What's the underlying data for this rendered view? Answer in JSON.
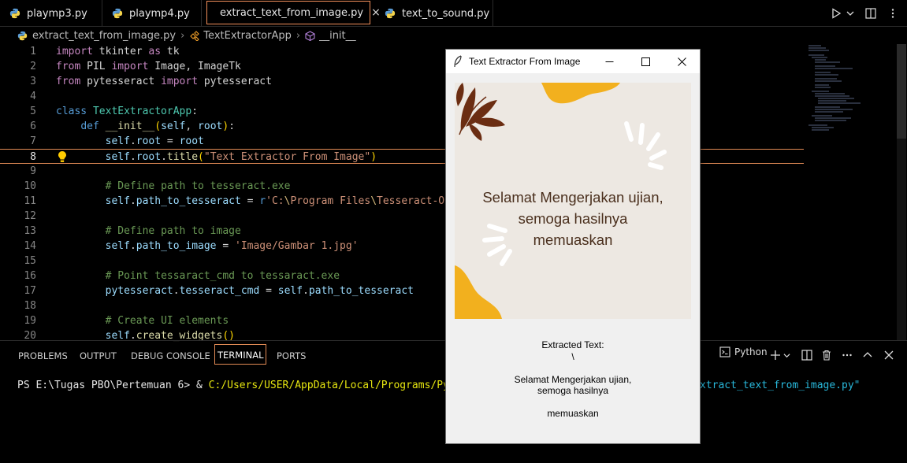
{
  "tabs": [
    {
      "label": "playmp3.py",
      "active": false
    },
    {
      "label": "playmp4.py",
      "active": false
    },
    {
      "label": "extract_text_from_image.py",
      "active": true
    },
    {
      "label": "text_to_sound.py",
      "active": false
    }
  ],
  "tab_close_glyph": "×",
  "breadcrumb": {
    "file": "extract_text_from_image.py",
    "class": "TextExtractorApp",
    "method": "__init__"
  },
  "code_lines": [
    {
      "n": "1",
      "segs": [
        [
          "k",
          "import"
        ],
        [
          "p",
          " tkinter "
        ],
        [
          "k",
          "as"
        ],
        [
          "p",
          " tk"
        ]
      ]
    },
    {
      "n": "2",
      "segs": [
        [
          "k",
          "from"
        ],
        [
          "p",
          " PIL "
        ],
        [
          "k",
          "import"
        ],
        [
          "p",
          " Image, ImageTk"
        ]
      ]
    },
    {
      "n": "3",
      "segs": [
        [
          "k",
          "from"
        ],
        [
          "p",
          " pytesseract "
        ],
        [
          "k",
          "import"
        ],
        [
          "p",
          " pytesseract"
        ]
      ]
    },
    {
      "n": "4",
      "segs": []
    },
    {
      "n": "5",
      "segs": [
        [
          "b",
          "class"
        ],
        [
          "p",
          " "
        ],
        [
          "t",
          "TextExtractorApp"
        ],
        [
          "p",
          ":"
        ]
      ]
    },
    {
      "n": "6",
      "segs": [
        [
          "p",
          "    "
        ],
        [
          "b",
          "def"
        ],
        [
          "p",
          " "
        ],
        [
          "f",
          "__init__"
        ],
        [
          "y",
          "("
        ],
        [
          "v",
          "self"
        ],
        [
          "p",
          ", "
        ],
        [
          "v",
          "root"
        ],
        [
          "y",
          ")"
        ],
        [
          "p",
          ":"
        ]
      ]
    },
    {
      "n": "7",
      "segs": [
        [
          "p",
          "        "
        ],
        [
          "v",
          "self"
        ],
        [
          "p",
          "."
        ],
        [
          "v",
          "root"
        ],
        [
          "p",
          " = "
        ],
        [
          "v",
          "root"
        ]
      ]
    },
    {
      "n": "8",
      "segs": [
        [
          "p",
          "        "
        ],
        [
          "v",
          "self"
        ],
        [
          "p",
          "."
        ],
        [
          "v",
          "root"
        ],
        [
          "p",
          "."
        ],
        [
          "f",
          "title"
        ],
        [
          "y",
          "("
        ],
        [
          "s",
          "\"Text Extractor From Image\""
        ],
        [
          "y",
          ")"
        ]
      ]
    },
    {
      "n": "9",
      "segs": []
    },
    {
      "n": "10",
      "segs": [
        [
          "p",
          "        "
        ],
        [
          "c",
          "# Define path to tesseract.exe"
        ]
      ]
    },
    {
      "n": "11",
      "segs": [
        [
          "p",
          "        "
        ],
        [
          "v",
          "self"
        ],
        [
          "p",
          "."
        ],
        [
          "v",
          "path_to_tesseract"
        ],
        [
          "p",
          " = "
        ],
        [
          "b",
          "r"
        ],
        [
          "s",
          "'C:"
        ],
        [
          "e",
          "\\"
        ],
        [
          "s",
          "Program Files"
        ],
        [
          "e",
          "\\"
        ],
        [
          "s",
          "Tesseract-OCR"
        ]
      ]
    },
    {
      "n": "12",
      "segs": []
    },
    {
      "n": "13",
      "segs": [
        [
          "p",
          "        "
        ],
        [
          "c",
          "# Define path to image"
        ]
      ]
    },
    {
      "n": "14",
      "segs": [
        [
          "p",
          "        "
        ],
        [
          "v",
          "self"
        ],
        [
          "p",
          "."
        ],
        [
          "v",
          "path_to_image"
        ],
        [
          "p",
          " = "
        ],
        [
          "s",
          "'Image/Gambar 1.jpg'"
        ]
      ]
    },
    {
      "n": "15",
      "segs": []
    },
    {
      "n": "16",
      "segs": [
        [
          "p",
          "        "
        ],
        [
          "c",
          "# Point tessaract_cmd to tessaract.exe"
        ]
      ]
    },
    {
      "n": "17",
      "segs": [
        [
          "p",
          "        "
        ],
        [
          "v",
          "pytesseract"
        ],
        [
          "p",
          "."
        ],
        [
          "v",
          "tesseract_cmd"
        ],
        [
          "p",
          " = "
        ],
        [
          "v",
          "self"
        ],
        [
          "p",
          "."
        ],
        [
          "v",
          "path_to_tesseract"
        ]
      ]
    },
    {
      "n": "18",
      "segs": []
    },
    {
      "n": "19",
      "segs": [
        [
          "p",
          "        "
        ],
        [
          "c",
          "# Create UI elements"
        ]
      ]
    },
    {
      "n": "20",
      "segs": [
        [
          "p",
          "        "
        ],
        [
          "v",
          "self"
        ],
        [
          "p",
          "."
        ],
        [
          "f",
          "create_widgets"
        ],
        [
          "y",
          "()"
        ]
      ]
    }
  ],
  "current_line": "8",
  "panel": {
    "tabs": [
      "PROBLEMS",
      "OUTPUT",
      "DEBUG CONSOLE",
      "TERMINAL",
      "PORTS"
    ],
    "active_tab": "TERMINAL",
    "terminal_kind": "Python",
    "terminal_prompt": "PS E:\\Tugas PBO\\Pertemuan 6> ",
    "terminal_amp": "& ",
    "terminal_cmd": "C:/Users/USER/AppData/Local/Programs/Python/Pyt",
    "terminal_tail": "xtract_text_from_image.py\""
  },
  "tk_window": {
    "title": "Text Extractor From Image",
    "image_text": "Selamat Mengerjakan ujian,\nsemoga hasilnya\nmemuaskan",
    "extracted": "Extracted Text:\n\\\n\nSelamat Mengerjakan ujian,\nsemoga hasilnya\n\nmemuaskan"
  },
  "colors": {
    "accent_border": "#e08a55",
    "image_bg": "#ede8e2",
    "blob_yellow": "#f2b01e",
    "leaf_brown": "#6b2d12"
  }
}
